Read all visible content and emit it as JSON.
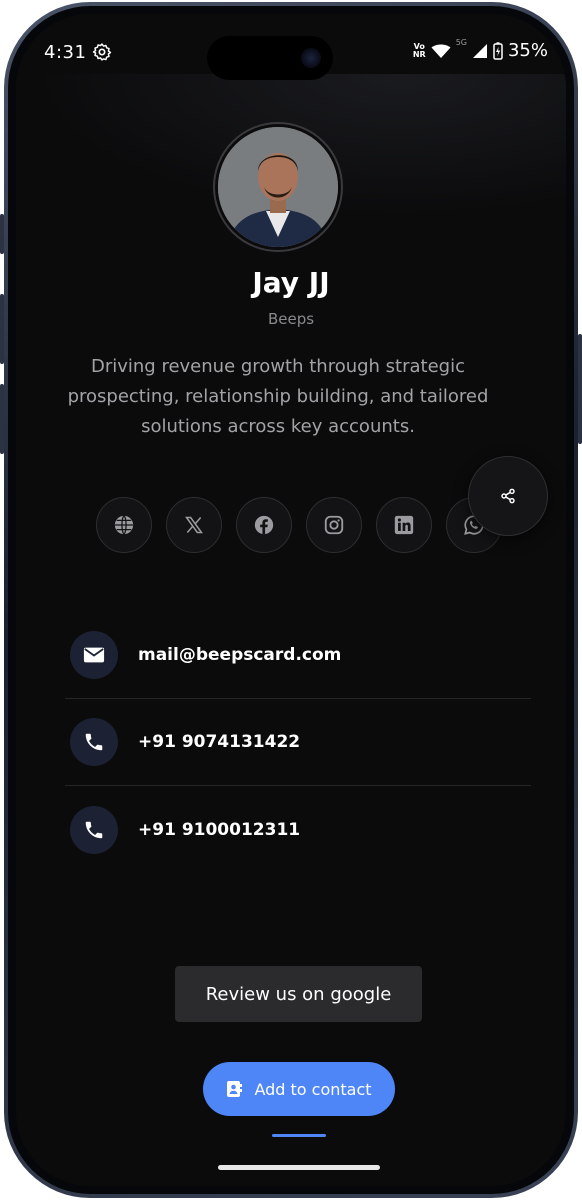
{
  "status_bar": {
    "time": "4:31",
    "network_top": "Vo",
    "network_bottom": "NR",
    "signal_label": "5G",
    "battery": "35%"
  },
  "profile": {
    "name": "Jay JJ",
    "company": "Beeps",
    "bio": "Driving revenue growth through strategic prospecting, relationship building, and tailored solutions across key accounts."
  },
  "socials": [
    {
      "icon": "globe-icon"
    },
    {
      "icon": "x-icon"
    },
    {
      "icon": "facebook-icon"
    },
    {
      "icon": "instagram-icon"
    },
    {
      "icon": "linkedin-icon"
    },
    {
      "icon": "whatsapp-icon"
    }
  ],
  "contacts": [
    {
      "icon": "mail-icon",
      "value": "mail@beepscard.com"
    },
    {
      "icon": "phone-icon",
      "value": "+91 9074131422"
    },
    {
      "icon": "phone-icon",
      "value": "+91 9100012311"
    }
  ],
  "actions": {
    "review_label": "Review us on google",
    "add_contact_label": "Add to contact"
  },
  "colors": {
    "background": "#0b0b0c",
    "accent": "#4f86f7",
    "icon_circle": "#1c2233"
  }
}
